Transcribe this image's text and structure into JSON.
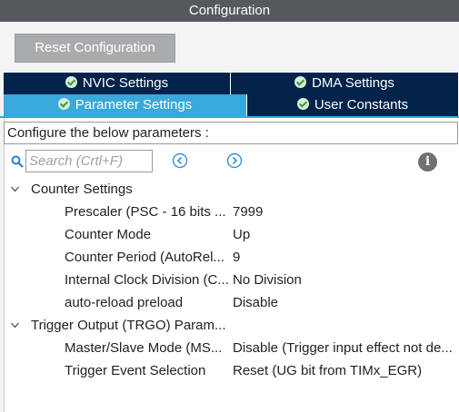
{
  "window": {
    "title": "Configuration"
  },
  "toolbar": {
    "reset_label": "Reset Configuration"
  },
  "tabs": [
    {
      "label": "NVIC Settings",
      "active": false
    },
    {
      "label": "DMA Settings",
      "active": false
    },
    {
      "label": "Parameter Settings",
      "active": true
    },
    {
      "label": "User Constants",
      "active": false
    }
  ],
  "description": "Configure the below parameters :",
  "search": {
    "placeholder": "Search (Crtl+F)",
    "value": ""
  },
  "icons": {
    "search": "search-icon",
    "prev": "previous-icon",
    "next": "next-icon",
    "info": "info-icon",
    "tab_check": "check-circle-icon",
    "group_expand": "chevron-down-icon"
  },
  "colors": {
    "accent": "#39a9dc",
    "tab_dark": "#03234b",
    "titlebar": "#55595e",
    "check": "#3c9a46"
  },
  "groups": [
    {
      "label": "Counter Settings",
      "params": [
        {
          "name": "Prescaler (PSC - 16 bits ...",
          "value": "7999"
        },
        {
          "name": "Counter Mode",
          "value": "Up"
        },
        {
          "name": "Counter Period (AutoRel...",
          "value": "9"
        },
        {
          "name": "Internal Clock Division (C...",
          "value": "No Division"
        },
        {
          "name": "auto-reload preload",
          "value": "Disable"
        }
      ]
    },
    {
      "label": "Trigger Output (TRGO) Param...",
      "params": [
        {
          "name": "Master/Slave Mode (MS...",
          "value": "Disable (Trigger input effect not de..."
        },
        {
          "name": "Trigger Event Selection",
          "value": "Reset (UG bit from TIMx_EGR)"
        }
      ]
    }
  ]
}
